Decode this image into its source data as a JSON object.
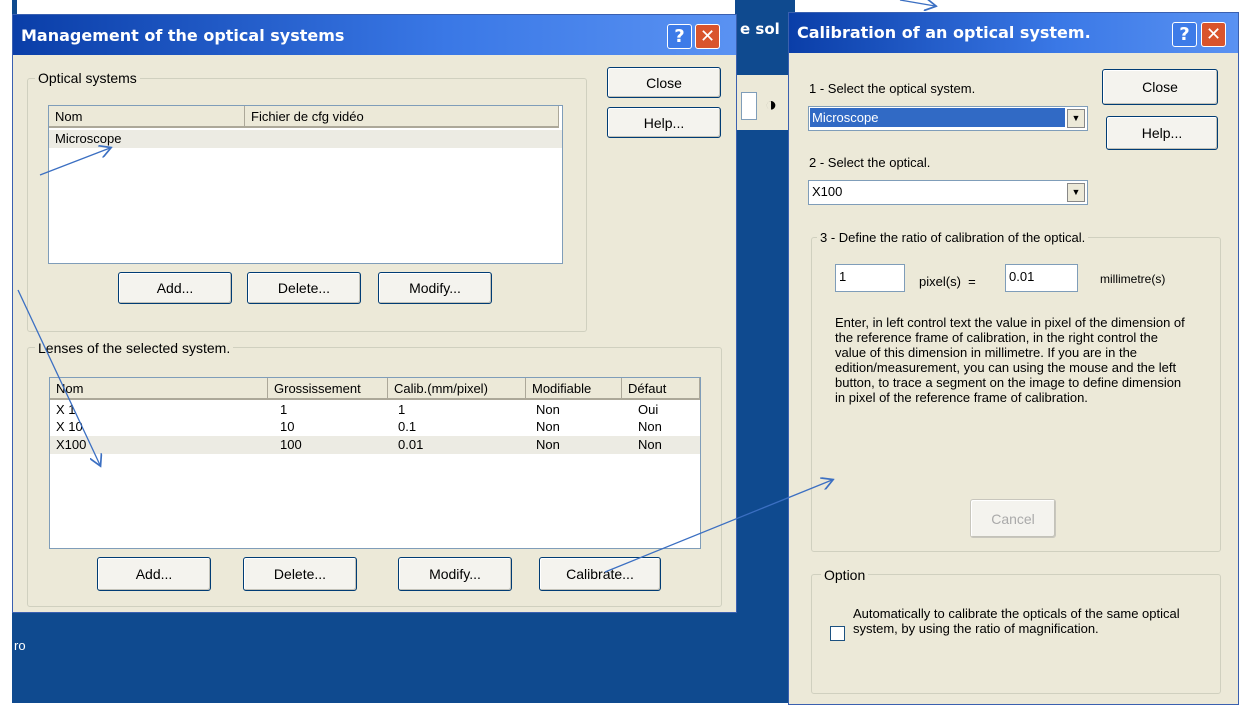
{
  "background": {
    "partial_title": "e sol",
    "bottom_text": "ro",
    "contrast_glyph": "◑"
  },
  "management_window": {
    "title": "Management of the optical systems",
    "help_glyph": "?",
    "close_glyph": "✕",
    "close_button": "Close",
    "help_button": "Help...",
    "optical_systems_group": "Optical systems",
    "systems_columns": [
      "Nom",
      "Fichier de cfg vidéo"
    ],
    "systems_rows": [
      [
        "Microscope",
        ""
      ]
    ],
    "systems_buttons": {
      "add": "Add...",
      "delete": "Delete...",
      "modify": "Modify..."
    },
    "lenses_group": "Lenses of the selected system.",
    "lenses_columns": [
      "Nom",
      "Grossissement",
      "Calib.(mm/pixel)",
      "Modifiable",
      "Défaut"
    ],
    "lenses_rows": [
      [
        "X 1",
        "1",
        "1",
        "Non",
        "Oui"
      ],
      [
        "X 10",
        "10",
        "0.1",
        "Non",
        "Non"
      ],
      [
        "X100",
        "100",
        "0.01",
        "Non",
        "Non"
      ]
    ],
    "lenses_buttons": {
      "add": "Add...",
      "delete": "Delete...",
      "modify": "Modify...",
      "calibrate": "Calibrate..."
    }
  },
  "calibration_window": {
    "title": "Calibration of an optical system.",
    "help_glyph": "?",
    "close_glyph": "✕",
    "close_button": "Close",
    "help_button": "Help...",
    "step1_label": "1 - Select the optical system.",
    "step1_value": "Microscope",
    "step2_label": "2 - Select the optical.",
    "step2_value": "X100",
    "step3_group": "3 - Define the ratio of calibration of the optical.",
    "pixel_value": "1",
    "pixel_unit": "pixel(s)  =",
    "mm_value": "0.01",
    "mm_unit": "millimetre(s)",
    "instructions": "Enter, in left control text the value in pixel of the dimension of the reference frame of calibration, in the right control the value of this dimension in millimetre. If you are in the edition/measurement, you can using the mouse and the left button, to trace a segment on the image to define dimension in pixel of the reference frame of calibration.",
    "cancel_button": "Cancel",
    "option_group": "Option",
    "option_checkbox_label": "Automatically to calibrate the opticals of the same optical system, by using the ratio of magnification.",
    "option_checked": false
  },
  "colors": {
    "title_bar": "#0a3ea8",
    "window_face": "#ece9d8",
    "selection": "#316ac5",
    "desktop": "#0f4a8f",
    "close_button": "#d9542c",
    "arrow": "#3b6fc2"
  }
}
